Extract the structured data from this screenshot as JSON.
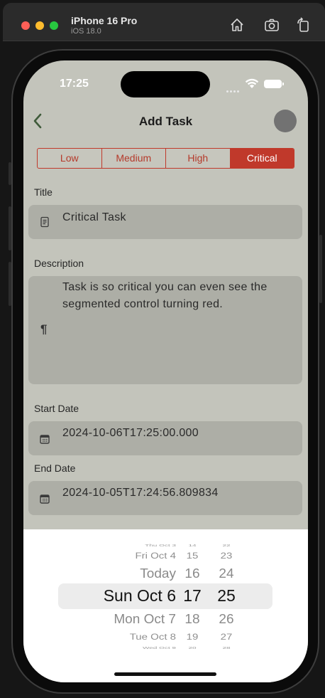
{
  "simulator": {
    "device_name": "iPhone 16 Pro",
    "os_version": "iOS 18.0",
    "icons": [
      "home-icon",
      "screenshot-icon",
      "rotate-icon"
    ]
  },
  "status_bar": {
    "time": "17:25"
  },
  "nav": {
    "title": "Add Task"
  },
  "priority": {
    "options": [
      "Low",
      "Medium",
      "High",
      "Critical"
    ],
    "selected": "Critical"
  },
  "form": {
    "title_label": "Title",
    "title_value": "Critical Task",
    "description_label": "Description",
    "description_line1": "Task is so critical you can even see the",
    "description_line2": "segmented control turning red.",
    "description_icon_glyph": "¶",
    "start_date_label": "Start Date",
    "start_date_value": "2024-10-06T17:25:00.000",
    "end_date_label": "End Date",
    "end_date_value": "2024-10-05T17:24:56.809834"
  },
  "picker": {
    "rows": [
      {
        "date": "Thu Oct 3",
        "hour": "14",
        "minute": "22"
      },
      {
        "date": "Fri Oct 4",
        "hour": "15",
        "minute": "23"
      },
      {
        "date": "Today",
        "hour": "16",
        "minute": "24"
      },
      {
        "date": "Sun Oct 6",
        "hour": "17",
        "minute": "25"
      },
      {
        "date": "Mon Oct 7",
        "hour": "18",
        "minute": "26"
      },
      {
        "date": "Tue Oct 8",
        "hour": "19",
        "minute": "27"
      },
      {
        "date": "Wed Oct 9",
        "hour": "20",
        "minute": "28"
      }
    ],
    "selected_index": 3
  },
  "colors": {
    "accent": "#c0392b",
    "screen_bg": "#c3c4bb",
    "field_bg": "#adaea6"
  }
}
